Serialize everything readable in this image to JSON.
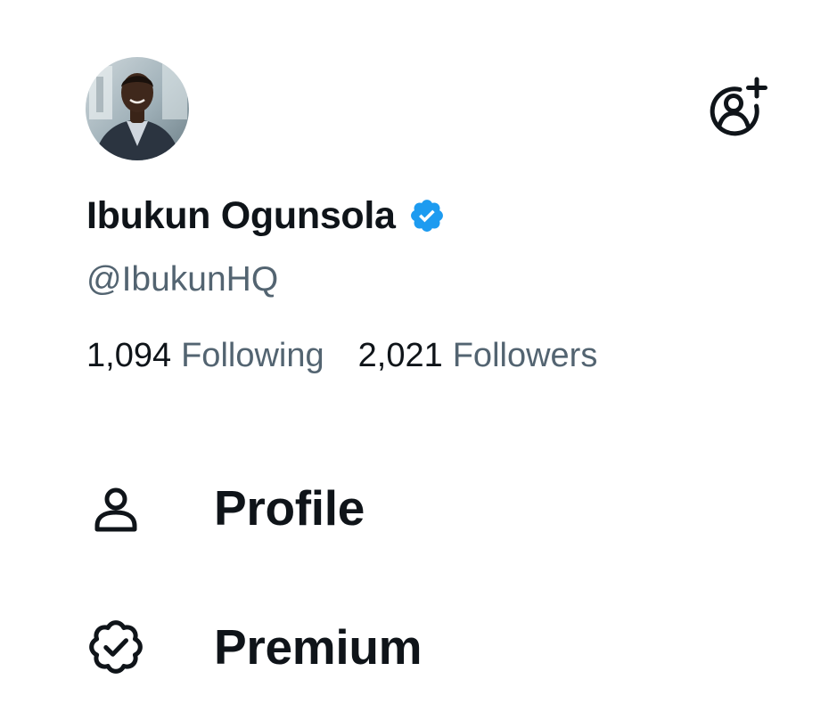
{
  "account": {
    "display_name": "Ibukun Ogunsola",
    "handle": "@IbukunHQ",
    "verified": true,
    "avatar_icon": "profile-photo"
  },
  "stats": {
    "following_count": "1,094",
    "following_label": "Following",
    "followers_count": "2,021",
    "followers_label": "Followers"
  },
  "header": {
    "add_account_icon": "add-account-icon"
  },
  "menu": {
    "items": [
      {
        "label": "Profile",
        "icon": "person-icon"
      },
      {
        "label": "Premium",
        "icon": "verified-check-icon"
      }
    ]
  },
  "colors": {
    "text_primary": "#0f1419",
    "text_secondary": "#536471",
    "verified_blue": "#1d9bf0",
    "background": "#ffffff"
  }
}
